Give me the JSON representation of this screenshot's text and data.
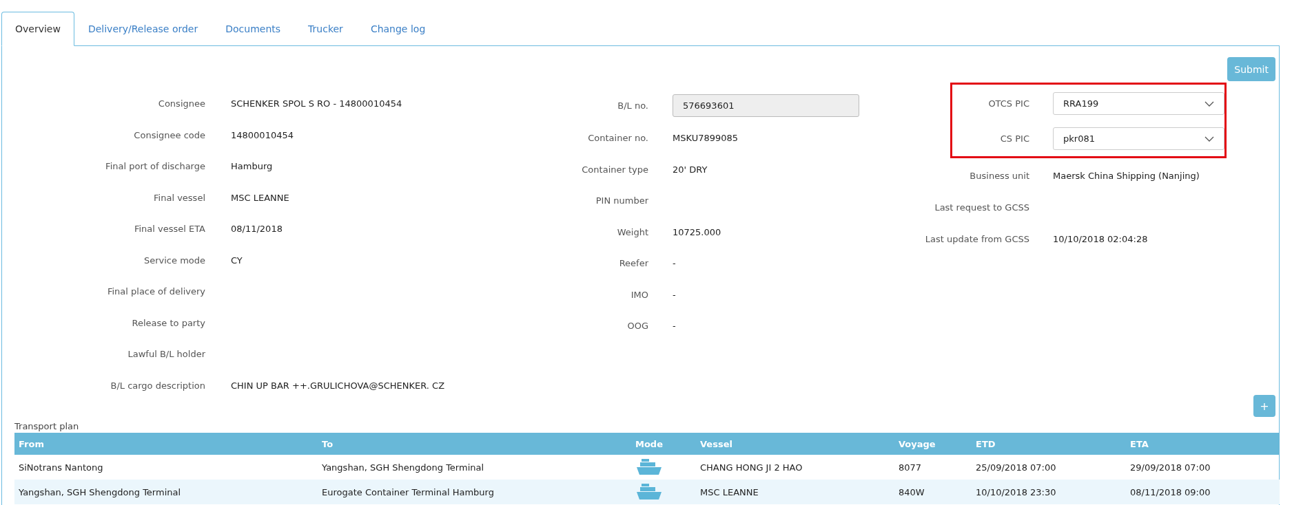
{
  "tabs": [
    {
      "label": "Overview",
      "selected": true
    },
    {
      "label": "Delivery/Release order",
      "selected": false
    },
    {
      "label": "Documents",
      "selected": false
    },
    {
      "label": "Trucker",
      "selected": false
    },
    {
      "label": "Change log",
      "selected": false
    }
  ],
  "submit_button": "Submit",
  "left_fields": [
    {
      "label": "Consignee",
      "value": "SCHENKER SPOL S RO - 14800010454"
    },
    {
      "label": "Consignee code",
      "value": "14800010454"
    },
    {
      "label": "Final port of discharge",
      "value": "Hamburg"
    },
    {
      "label": "Final vessel",
      "value": "MSC LEANNE"
    },
    {
      "label": "Final vessel ETA",
      "value": "08/11/2018"
    },
    {
      "label": "Service mode",
      "value": "CY"
    },
    {
      "label": "Final place of delivery"
    },
    {
      "label": "Release to party"
    },
    {
      "label": "Lawful B/L holder"
    },
    {
      "label": "B/L cargo description",
      "value": "CHIN UP BAR ++.GRULICHOVA@SCHENKER. CZ"
    }
  ],
  "middle_fields": [
    {
      "label": "B/L no.",
      "kind": "input",
      "value": "576693601"
    },
    {
      "label": "Container no.",
      "kind": "text",
      "value": "MSKU7899085"
    },
    {
      "label": "Container type",
      "kind": "text",
      "value": "20' DRY"
    },
    {
      "label": "PIN number",
      "kind": "text"
    },
    {
      "label": "Weight",
      "kind": "text",
      "value": "10725.000"
    },
    {
      "label": "Reefer",
      "kind": "text",
      "value": "-"
    },
    {
      "label": "IMO",
      "kind": "text",
      "value": "-"
    },
    {
      "label": "OOG",
      "kind": "text",
      "value": "-"
    }
  ],
  "right_fields": [
    {
      "label": "OTCS PIC",
      "kind": "select",
      "value": "RRA199",
      "highlighted": true
    },
    {
      "label": "CS PIC",
      "kind": "select",
      "value": "pkr081",
      "highlighted": true
    },
    {
      "label": "Business unit",
      "kind": "text",
      "value": "Maersk China Shipping (Nanjing)",
      "highlighted": false
    },
    {
      "label": "Last request to GCSS",
      "kind": "text",
      "highlighted": false
    },
    {
      "label": "Last update from GCSS",
      "kind": "text",
      "value": "10/10/2018 02:04:28",
      "highlighted": false
    }
  ],
  "add_button": "+",
  "transport_plan": {
    "title": "Transport plan",
    "columns": [
      "From",
      "To",
      "Mode",
      "Vessel",
      "Voyage",
      "ETD",
      "ETA"
    ],
    "rows": [
      {
        "from": "SiNotrans Nantong",
        "to": "Yangshan, SGH Shengdong Terminal",
        "kind": "ship",
        "vessel": "CHANG HONG JI 2 HAO",
        "voyage": "8077",
        "etd": "25/09/2018 07:00",
        "eta": "29/09/2018 07:00"
      },
      {
        "from": "Yangshan, SGH Shengdong Terminal",
        "to": "Eurogate Container Terminal Hamburg",
        "kind": "ship",
        "vessel": "MSC LEANNE",
        "voyage": "840W",
        "etd": "10/10/2018 23:30",
        "eta": "08/11/2018 09:00"
      }
    ]
  }
}
